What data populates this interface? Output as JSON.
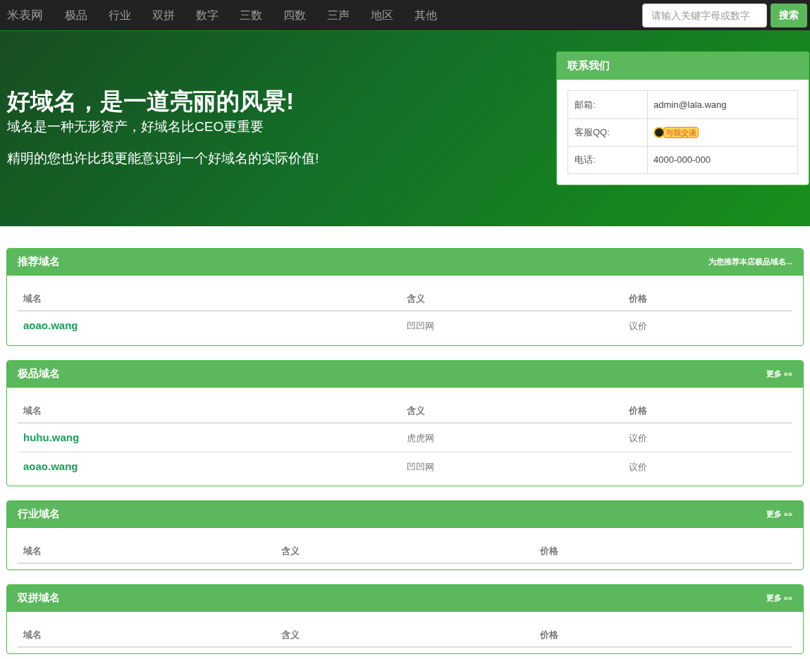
{
  "navbar": {
    "brand": "米表网",
    "items": [
      "极品",
      "行业",
      "双拼",
      "数字",
      "三数",
      "四数",
      "三声",
      "地区",
      "其他"
    ],
    "search": {
      "placeholder": "请输入关键字母或数字",
      "button": "搜索"
    }
  },
  "hero": {
    "title": "好域名，是一道亮丽的风景!",
    "subtitle": "域名是一种无形资产，好域名比CEO更重要",
    "text": "精明的您也许比我更能意识到一个好域名的实际价值!"
  },
  "contact": {
    "title": "联系我们",
    "rows": [
      {
        "kind": "text",
        "label": "邮箱:",
        "value": "admin@lala.wang"
      },
      {
        "kind": "qq",
        "label": "客服QQ:",
        "value": "与我交谈"
      },
      {
        "kind": "text",
        "label": "电话:",
        "value": "4000-000-000"
      }
    ]
  },
  "panels": [
    {
      "title": "推荐域名",
      "link": "为您推荐本店极品域名...",
      "columns": [
        "域名",
        "含义",
        "价格"
      ],
      "rows": [
        [
          "aoao.wang",
          "凹凹网",
          "议价"
        ]
      ]
    },
    {
      "title": "极品域名",
      "link": "更多 »»",
      "columns": [
        "域名",
        "含义",
        "价格"
      ],
      "rows": [
        [
          "huhu.wang",
          "虎虎网",
          "议价"
        ],
        [
          "aoao.wang",
          "凹凹网",
          "议价"
        ]
      ]
    },
    {
      "title": "行业域名",
      "link": "更多 »»",
      "columns": [
        "域名",
        "含义",
        "价格"
      ]
    },
    {
      "title": "双拼域名",
      "link": "更多 »»",
      "columns": [
        "域名",
        "含义",
        "价格"
      ]
    }
  ]
}
